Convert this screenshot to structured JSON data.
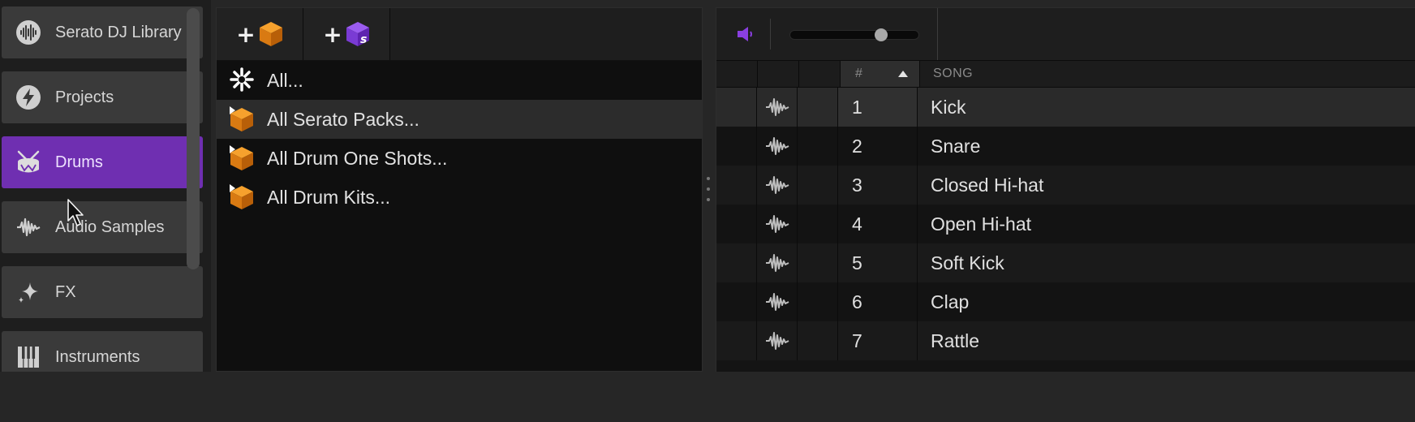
{
  "sidebar": {
    "items": [
      {
        "label": "Serato DJ Library",
        "icon": "serato-library-icon"
      },
      {
        "label": "Projects",
        "icon": "lightning-icon"
      },
      {
        "label": "Drums",
        "icon": "drum-icon",
        "active": true
      },
      {
        "label": "Audio Samples",
        "icon": "waveform-icon"
      },
      {
        "label": "FX",
        "icon": "sparkle-icon"
      },
      {
        "label": "Instruments",
        "icon": "piano-icon"
      }
    ]
  },
  "packs": {
    "toolbar": {
      "add_pack_icon": "add-pack-icon",
      "add_serato_pack_icon": "add-serato-pack-icon"
    },
    "rows": [
      {
        "label": "All...",
        "icon": "asterisk-icon"
      },
      {
        "label": "All Serato Packs...",
        "icon": "pack-icon",
        "selected": true
      },
      {
        "label": "All Drum One Shots...",
        "icon": "pack-icon"
      },
      {
        "label": "All Drum Kits...",
        "icon": "pack-icon"
      }
    ]
  },
  "player": {
    "volume_icon": "speaker-icon",
    "volume_level": 0.72,
    "accent_color": "#8a3fe0"
  },
  "table": {
    "headers": {
      "num": "#",
      "song": "SONG"
    },
    "sort": "ascending",
    "rows": [
      {
        "num": "1",
        "song": "Kick"
      },
      {
        "num": "2",
        "song": "Snare"
      },
      {
        "num": "3",
        "song": "Closed Hi-hat"
      },
      {
        "num": "4",
        "song": "Open Hi-hat"
      },
      {
        "num": "5",
        "song": "Soft Kick"
      },
      {
        "num": "6",
        "song": "Clap"
      },
      {
        "num": "7",
        "song": "Rattle"
      }
    ]
  }
}
